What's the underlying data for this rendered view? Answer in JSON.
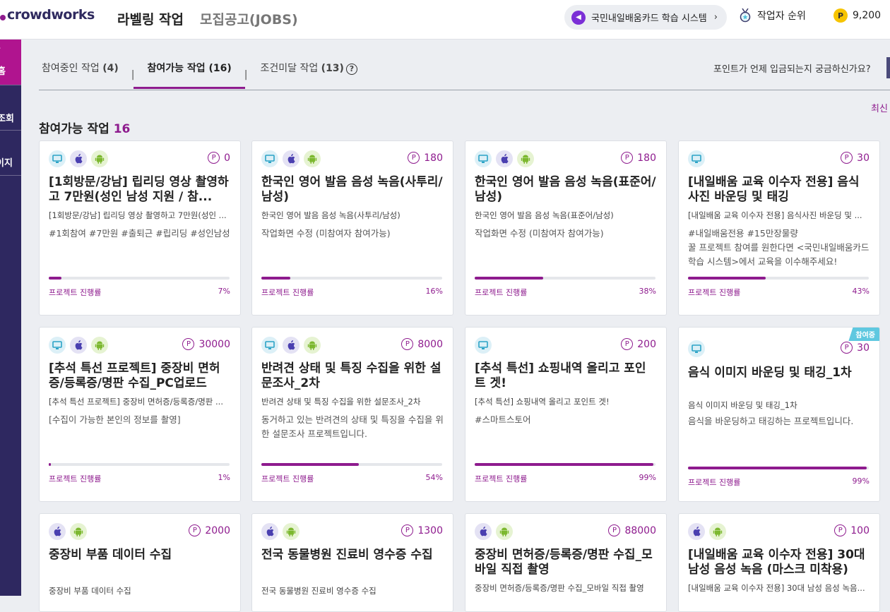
{
  "header": {
    "logo": "crowdworks",
    "nav": [
      "라벨링 작업",
      "모집공고(JOBS)"
    ],
    "learning_system": "국민내일배움카드 학습 시스템",
    "ranking": "작업자 순위",
    "points": "9,200",
    "point_symbol": "P"
  },
  "sidebar": {
    "items": [
      "홈",
      "조회",
      "이지"
    ]
  },
  "tabs": [
    {
      "label": "참여중인 작업",
      "count": "(4)"
    },
    {
      "label": "참여가능 작업",
      "count": "(16)"
    },
    {
      "label": "조건미달 작업",
      "count": "(13)"
    }
  ],
  "faq": "포인트가 언제 입금되는지 궁금하신가요?",
  "sort": "최신",
  "section": {
    "title": "참여가능 작업",
    "count": "16"
  },
  "progress_label": "프로젝트 진행률",
  "cards": [
    {
      "title": "[1회방문/강남] 립리딩 영상 촬영하고 7만원(성인 남성 지원 / 참...",
      "subtitle": "[1회방문/강남] 립리딩 영상 촬영하고 7만원(성인 ...",
      "desc": "#1회참여 #7만원 #출퇴근 #립리딩 #성인남성",
      "points": "0",
      "progress": 7,
      "progress_text": "7%",
      "platforms": [
        "pc",
        "ios",
        "android"
      ]
    },
    {
      "title": "한국인 영어 발음 음성 녹음(사투리/남성)",
      "subtitle": "한국인 영어 발음 음성 녹음(사투리/남성)",
      "desc": "작업화면 수정 (미참여자 참여가능)",
      "points": "180",
      "progress": 16,
      "progress_text": "16%",
      "platforms": [
        "pc",
        "ios",
        "android"
      ]
    },
    {
      "title": "한국인 영어 발음 음성 녹음(표준어/남성)",
      "subtitle": "한국인 영어 발음 음성 녹음(표준어/남성)",
      "desc": "작업화면 수정 (미참여자 참여가능)",
      "points": "180",
      "progress": 38,
      "progress_text": "38%",
      "platforms": [
        "pc",
        "ios",
        "android"
      ]
    },
    {
      "title": "[내일배움 교육 이수자 전용] 음식사진 바운딩 및 태깅",
      "subtitle": "[내일배움 교육 이수자 전용] 음식사진 바운딩 및 ...",
      "desc": "#내일배움전용 #15만장물량\n꿀 프로젝트 참여를 원한다면 <국민내일배움카드 학습 시스템>에서 교육을 이수해주세요!",
      "points": "30",
      "progress": 43,
      "progress_text": "43%",
      "platforms": [
        "pc"
      ]
    },
    {
      "title": "[추석 특선 프로젝트] 중장비 면허증/등록증/명판 수집_PC업로드",
      "subtitle": "[추석 특선 프로젝트] 중장비 면허증/등록증/명판 ...",
      "desc": "[수집이 가능한 본인의 정보를 촬영]",
      "points": "30000",
      "progress": 1,
      "progress_text": "1%",
      "platforms": [
        "pc",
        "ios",
        "android"
      ]
    },
    {
      "title": "반려견 상태 및 특징 수집을 위한 설문조사_2차",
      "subtitle": "반려견 상태 및 특징 수집을 위한 설문조사_2차",
      "desc": "동거하고 있는 반려견의 상태 및 특징을 수집을 위한 설문조사 프로젝트입니다.",
      "points": "8000",
      "progress": 54,
      "progress_text": "54%",
      "platforms": [
        "pc",
        "ios",
        "android"
      ]
    },
    {
      "title": "[추석 특선] 쇼핑내역 올리고 포인트 겟!",
      "subtitle": "[추석 특선] 쇼핑내역 올리고 포인트 겟!",
      "desc": "#스마트스토어",
      "points": "200",
      "progress": 99,
      "progress_text": "99%",
      "platforms": [
        "pc"
      ]
    },
    {
      "title": "음식 이미지 바운딩 및 태깅_1차",
      "subtitle": "음식 이미지 바운딩 및 태깅_1차",
      "desc": "음식을 바운딩하고 태깅하는 프로젝트입니다.",
      "points": "30",
      "progress": 99,
      "progress_text": "99%",
      "platforms": [
        "pc"
      ],
      "badge": "참여중"
    },
    {
      "title": "중장비 부품 데이터 수집",
      "subtitle": "중장비 부품 데이터 수집",
      "desc": "",
      "points": "2000",
      "platforms": [
        "ios",
        "android"
      ]
    },
    {
      "title": "전국 동물병원 진료비 영수증 수집",
      "subtitle": "전국 동물병원 진료비 영수증 수집",
      "desc": "",
      "points": "1300",
      "platforms": [
        "ios",
        "android"
      ]
    },
    {
      "title": "중장비 면허증/등록증/명판 수집_모바일 직접 촬영",
      "subtitle": "중장비 면허증/등록증/명판 수집_모바일 직접 촬영",
      "desc": "",
      "points": "88000",
      "platforms": [
        "ios",
        "android"
      ]
    },
    {
      "title": "[내일배움 교육 이수자 전용] 30대 남성 음성 녹음 (마스크 미착용)",
      "subtitle": "[내일배움 교육 이수자 전용] 30대 남성 음성 녹음...",
      "desc": "",
      "points": "100",
      "platforms": [
        "ios",
        "android"
      ]
    }
  ]
}
